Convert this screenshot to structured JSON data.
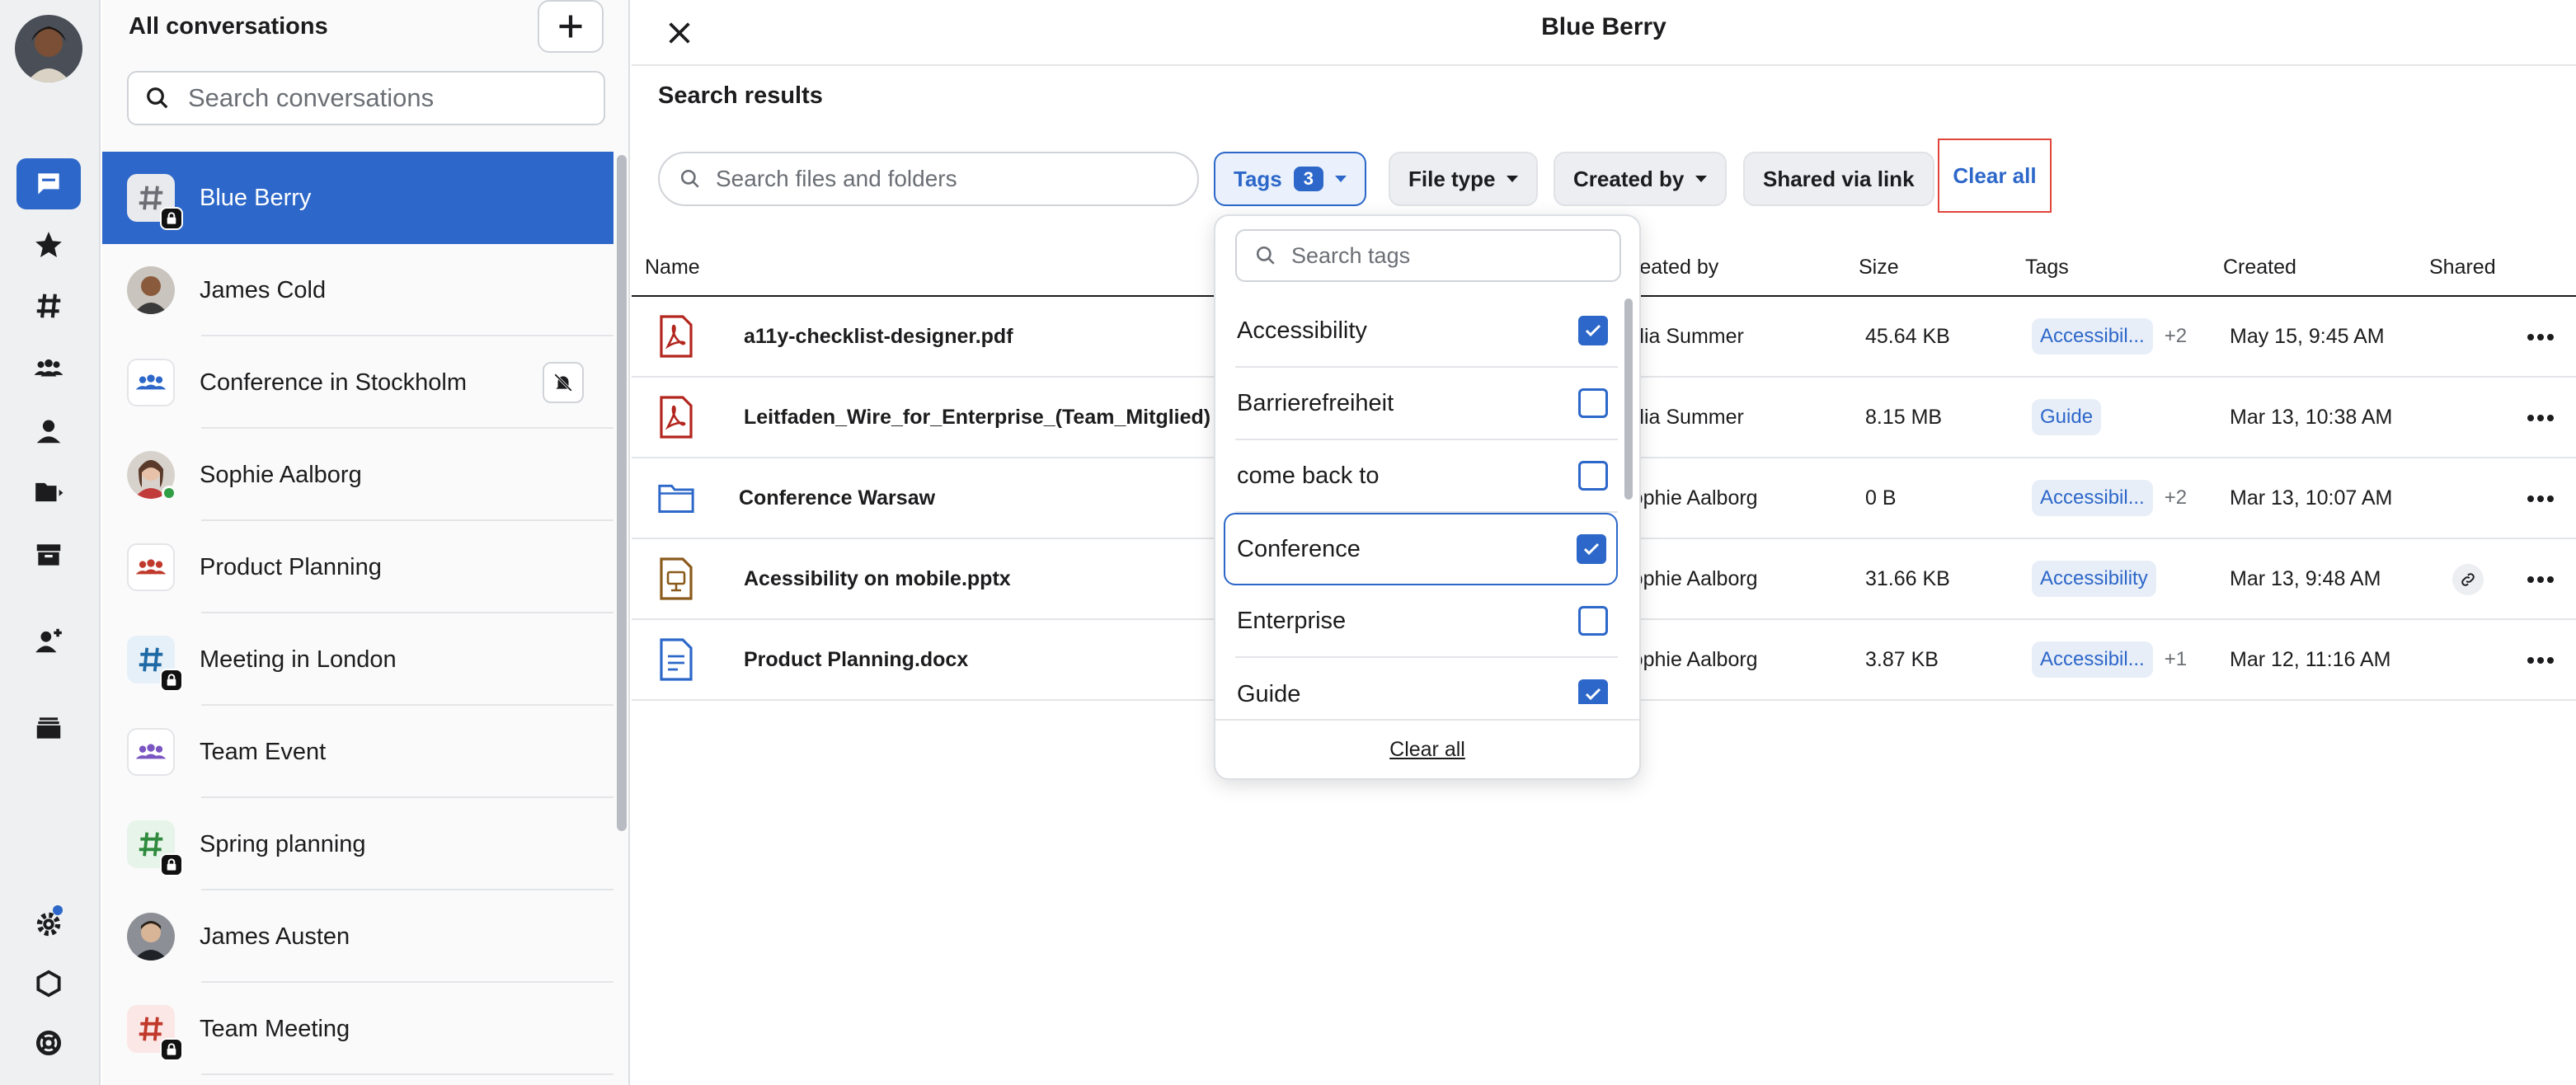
{
  "sidebar": {
    "title": "All conversations",
    "search_placeholder": "Search conversations",
    "conversations": [
      {
        "name": "Blue Berry",
        "kind": "channel-locked",
        "active": true
      },
      {
        "name": "James Cold",
        "kind": "person"
      },
      {
        "name": "Conference in Stockholm",
        "kind": "group",
        "muted": true
      },
      {
        "name": "Sophie Aalborg",
        "kind": "person",
        "online": true
      },
      {
        "name": "Product Planning",
        "kind": "group"
      },
      {
        "name": "Meeting in London",
        "kind": "channel-locked"
      },
      {
        "name": "Team Event",
        "kind": "group"
      },
      {
        "name": "Spring planning",
        "kind": "channel-locked"
      },
      {
        "name": "James Austen",
        "kind": "person"
      },
      {
        "name": "Team Meeting",
        "kind": "channel-locked"
      }
    ]
  },
  "rail": {
    "icons": [
      "chat-icon",
      "star-icon",
      "hash-icon",
      "people-icon",
      "person-icon",
      "folder-icon",
      "archive-icon",
      "add-person-icon",
      "stack-icon",
      "settings-icon",
      "hexagon-icon",
      "lifebuoy-icon"
    ]
  },
  "header": {
    "title": "Blue Berry"
  },
  "main": {
    "section_title": "Search results",
    "search_placeholder": "Search files and folders",
    "filters": {
      "tags_label": "Tags",
      "tags_count": "3",
      "file_type_label": "File type",
      "created_by_label": "Created by",
      "shared_label": "Shared via link",
      "clear_all_label": "Clear all"
    },
    "columns": {
      "name": "Name",
      "created_by": "Created by",
      "size": "Size",
      "tags": "Tags",
      "created": "Created",
      "shared": "Shared"
    },
    "rows": [
      {
        "name": "a11y-checklist-designer.pdf",
        "type": "pdf",
        "created_by": "Julia Summer",
        "size": "45.64 KB",
        "tag": "Accessibil...",
        "more": "+2",
        "created": "May 15, 9:45 AM",
        "shared": false
      },
      {
        "name": "Leitfaden_Wire_for_Enterprise_(Team_Mitglied)",
        "type": "pdf",
        "created_by": "Julia Summer",
        "size": "8.15 MB",
        "tag": "Guide",
        "more": "",
        "created": "Mar 13, 10:38 AM",
        "shared": false
      },
      {
        "name": "Conference Warsaw",
        "type": "folder",
        "created_by": "Sophie Aalborg",
        "size": "0 B",
        "tag": "Accessibil...",
        "more": "+2",
        "created": "Mar 13, 10:07 AM",
        "shared": false
      },
      {
        "name": "Acessibility on mobile.pptx",
        "type": "pptx",
        "created_by": "Sophie Aalborg",
        "size": "31.66 KB",
        "tag": "Accessibility",
        "more": "",
        "created": "Mar 13, 9:48 AM",
        "shared": true
      },
      {
        "name": "Product Planning.docx",
        "type": "docx",
        "created_by": "Sophie Aalborg",
        "size": "3.87 KB",
        "tag": "Accessibil...",
        "more": "+1",
        "created": "Mar 12, 11:16 AM",
        "shared": false
      }
    ]
  },
  "tags_dropdown": {
    "search_placeholder": "Search tags",
    "items": [
      {
        "label": "Accessibility",
        "checked": true
      },
      {
        "label": "Barrierefreiheit",
        "checked": false
      },
      {
        "label": "come back to",
        "checked": false
      },
      {
        "label": "Conference",
        "checked": true,
        "focused": true
      },
      {
        "label": "Enterprise",
        "checked": false
      },
      {
        "label": "Guide",
        "checked": true
      }
    ],
    "clear_all_label": "Clear all"
  },
  "colors": {
    "accent": "#2c67c9",
    "pdf": "#b3261e",
    "pptx": "#8a5a1c",
    "clear_all_outline": "#e0453c"
  }
}
